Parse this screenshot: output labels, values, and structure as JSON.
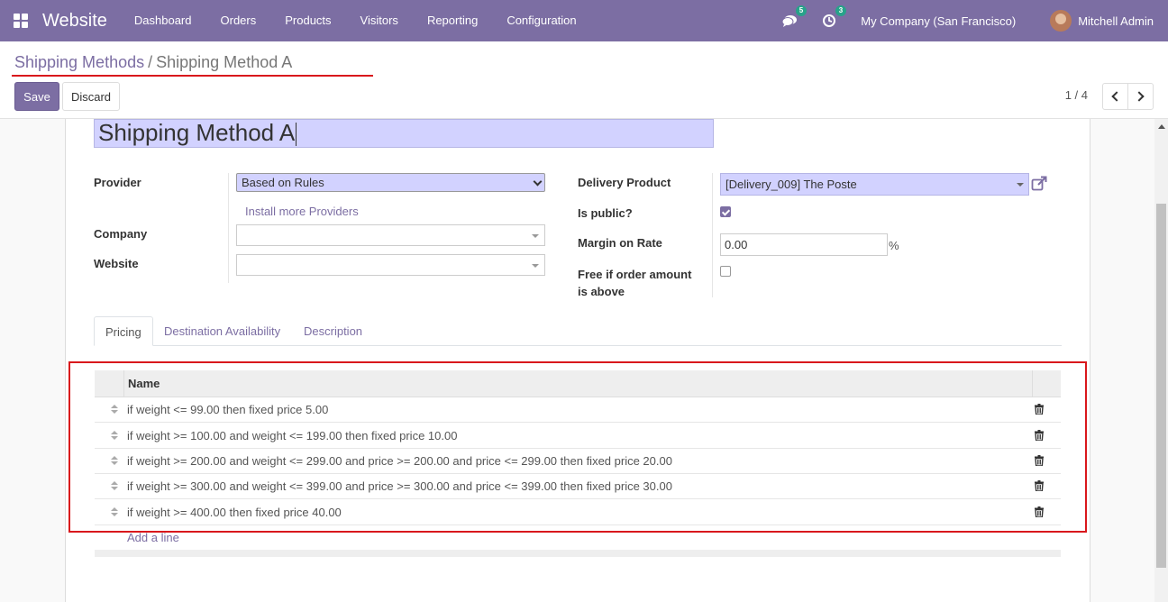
{
  "navbar": {
    "brand": "Website",
    "menu": [
      "Dashboard",
      "Orders",
      "Products",
      "Visitors",
      "Reporting",
      "Configuration"
    ],
    "chat_badge": "5",
    "activity_badge": "3",
    "company": "My Company (San Francisco)",
    "user": "Mitchell Admin"
  },
  "breadcrumb": {
    "parent": "Shipping Methods",
    "separator": "/",
    "current": "Shipping Method A"
  },
  "toolbar": {
    "save_label": "Save",
    "discard_label": "Discard",
    "pager": "1 / 4"
  },
  "form": {
    "name": "Shipping Method A",
    "provider_label": "Provider",
    "provider_value": "Based on Rules",
    "install_link": "Install more Providers",
    "company_label": "Company",
    "company_value": "",
    "website_label": "Website",
    "website_value": "",
    "delivery_product_label": "Delivery Product",
    "delivery_product_value": "[Delivery_009] The Poste",
    "is_public_label": "Is public?",
    "is_public": true,
    "margin_label": "Margin on Rate",
    "margin_value": "0.00",
    "margin_unit": "%",
    "free_label": "Free if order amount is above",
    "free_checked": false
  },
  "tabs": [
    "Pricing",
    "Destination Availability",
    "Description"
  ],
  "active_tab": "Pricing",
  "pricing_table": {
    "header": "Name",
    "rows": [
      "if weight <= 99.00 then fixed price 5.00",
      "if weight >= 100.00 and weight <= 199.00 then fixed price 10.00",
      "if weight >= 200.00 and weight <= 299.00 and price >= 200.00 and price <= 299.00 then fixed price 20.00",
      "if weight >= 300.00 and weight <= 399.00 and price >= 300.00 and price <= 399.00 then fixed price 30.00",
      "if weight >= 400.00 then fixed price 40.00"
    ],
    "add_line": "Add a line"
  },
  "colors": {
    "brand": "#7c6ea3",
    "required_field": "#d2d2ff",
    "highlight": "#d9181c"
  }
}
